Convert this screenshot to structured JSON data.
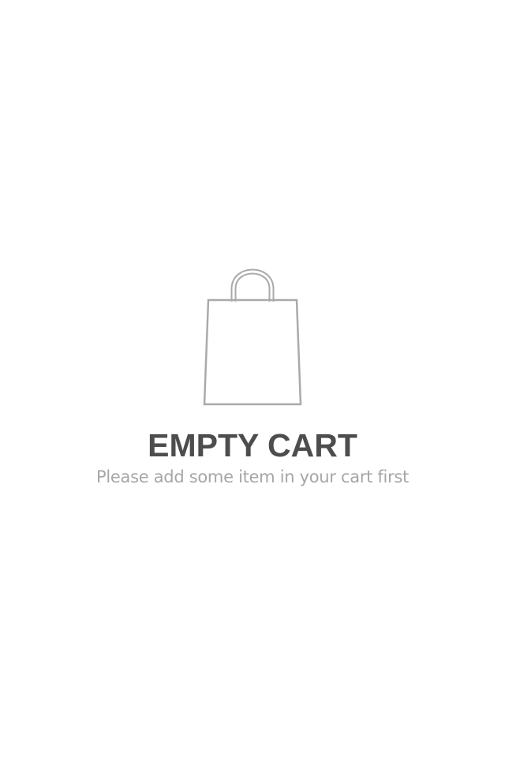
{
  "empty_state": {
    "icon": "shopping-bag-icon",
    "title": "EMPTY CART",
    "message": "Please add some item in your cart first"
  },
  "colors": {
    "background": "#ffffff",
    "icon_stroke": "#aaaaaa",
    "title": "#4d4d4d",
    "message": "#a6a6a6"
  }
}
